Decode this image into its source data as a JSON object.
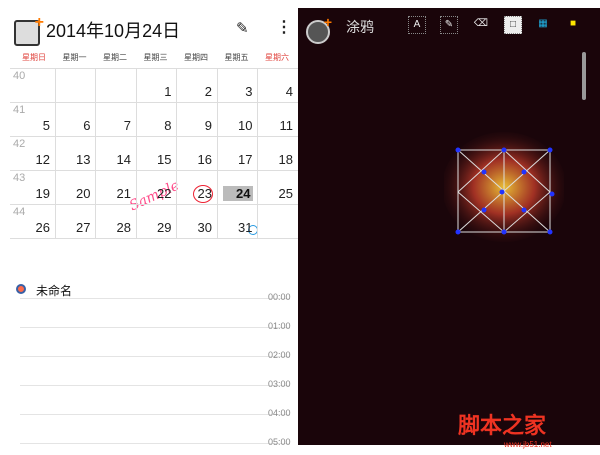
{
  "calendar": {
    "title": "2014年10月24日",
    "weekdays": [
      "星期日",
      "星期一",
      "星期二",
      "星期三",
      "星期四",
      "星期五",
      "星期六"
    ],
    "weeks": [
      {
        "num": "40",
        "days": [
          "",
          "",
          "",
          "1",
          "2",
          "3",
          "4"
        ]
      },
      {
        "num": "41",
        "days": [
          "5",
          "6",
          "7",
          "8",
          "9",
          "10",
          "11"
        ]
      },
      {
        "num": "42",
        "days": [
          "12",
          "13",
          "14",
          "15",
          "16",
          "17",
          "18"
        ]
      },
      {
        "num": "43",
        "days": [
          "19",
          "20",
          "21",
          "22",
          "23",
          "24",
          "25"
        ]
      },
      {
        "num": "44",
        "days": [
          "26",
          "27",
          "28",
          "29",
          "30",
          "31",
          ""
        ]
      }
    ],
    "today": "24",
    "handwriting": "Sample"
  },
  "events": {
    "name": "未命名",
    "times": [
      "00:00",
      "01:00",
      "02:00",
      "03:00",
      "04:00",
      "05:00"
    ]
  },
  "drawing": {
    "title": "涂鸦",
    "tools": [
      "A",
      "✎",
      "⌫",
      "□",
      "▦",
      "■"
    ]
  },
  "watermark": {
    "text": "脚本之家",
    "url": "www.jb51.net"
  },
  "colors": {
    "sunday": "#e0443e",
    "accent": "#2a9be0",
    "yellow": "#ffe600",
    "cyan": "#1fb5e8"
  }
}
